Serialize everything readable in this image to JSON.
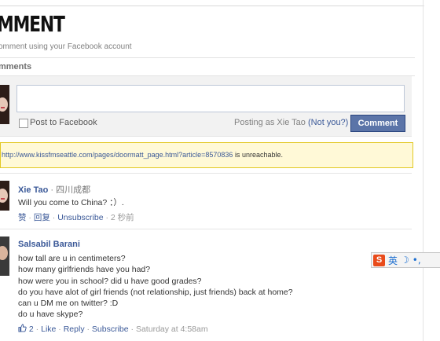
{
  "header": {
    "title": "MMENT",
    "subtitle": "omment using your Facebook account"
  },
  "comments_section": {
    "label": "mments"
  },
  "composer": {
    "post_to_facebook": "Post to Facebook",
    "posting_as": "Posting as Xie Tao",
    "not_you": "(Not you?)",
    "submit_label": "Comment"
  },
  "warning": {
    "url": "http://www.kissfmseattle.com/pages/doormatt_page.html?article=8570836",
    "message": "is unreachable."
  },
  "comments": [
    {
      "author": "Xie Tao",
      "location": "四川成都",
      "lines": [
        "Will you come to China? ：）."
      ],
      "actions": {
        "like": "赞",
        "reply": "回复",
        "unsubscribe": "Unsubscribe",
        "time": "2 秒前"
      }
    },
    {
      "author": "Salsabil Barani",
      "lines": [
        "how tall are u in centimeters?",
        "how many girlfriends have you had?",
        "how were you in school? did u have good grades?",
        "do you have alot of girl friends (not relationship, just friends) back at home?",
        "can u DM me on twitter? :D",
        "do u have skype?"
      ],
      "actions": {
        "like_count": "2",
        "like": "Like",
        "reply": "Reply",
        "subscribe": "Subscribe",
        "time": "Saturday at 4:58am"
      }
    }
  ],
  "ime_toolbar": {
    "logo": "S",
    "lang": "英",
    "moon": "☽",
    "punct": "•,"
  },
  "colors": {
    "link": "#3b5998",
    "button": "#5b74a8",
    "warning_bg": "#fff9d7",
    "warning_border": "#e2c822"
  }
}
